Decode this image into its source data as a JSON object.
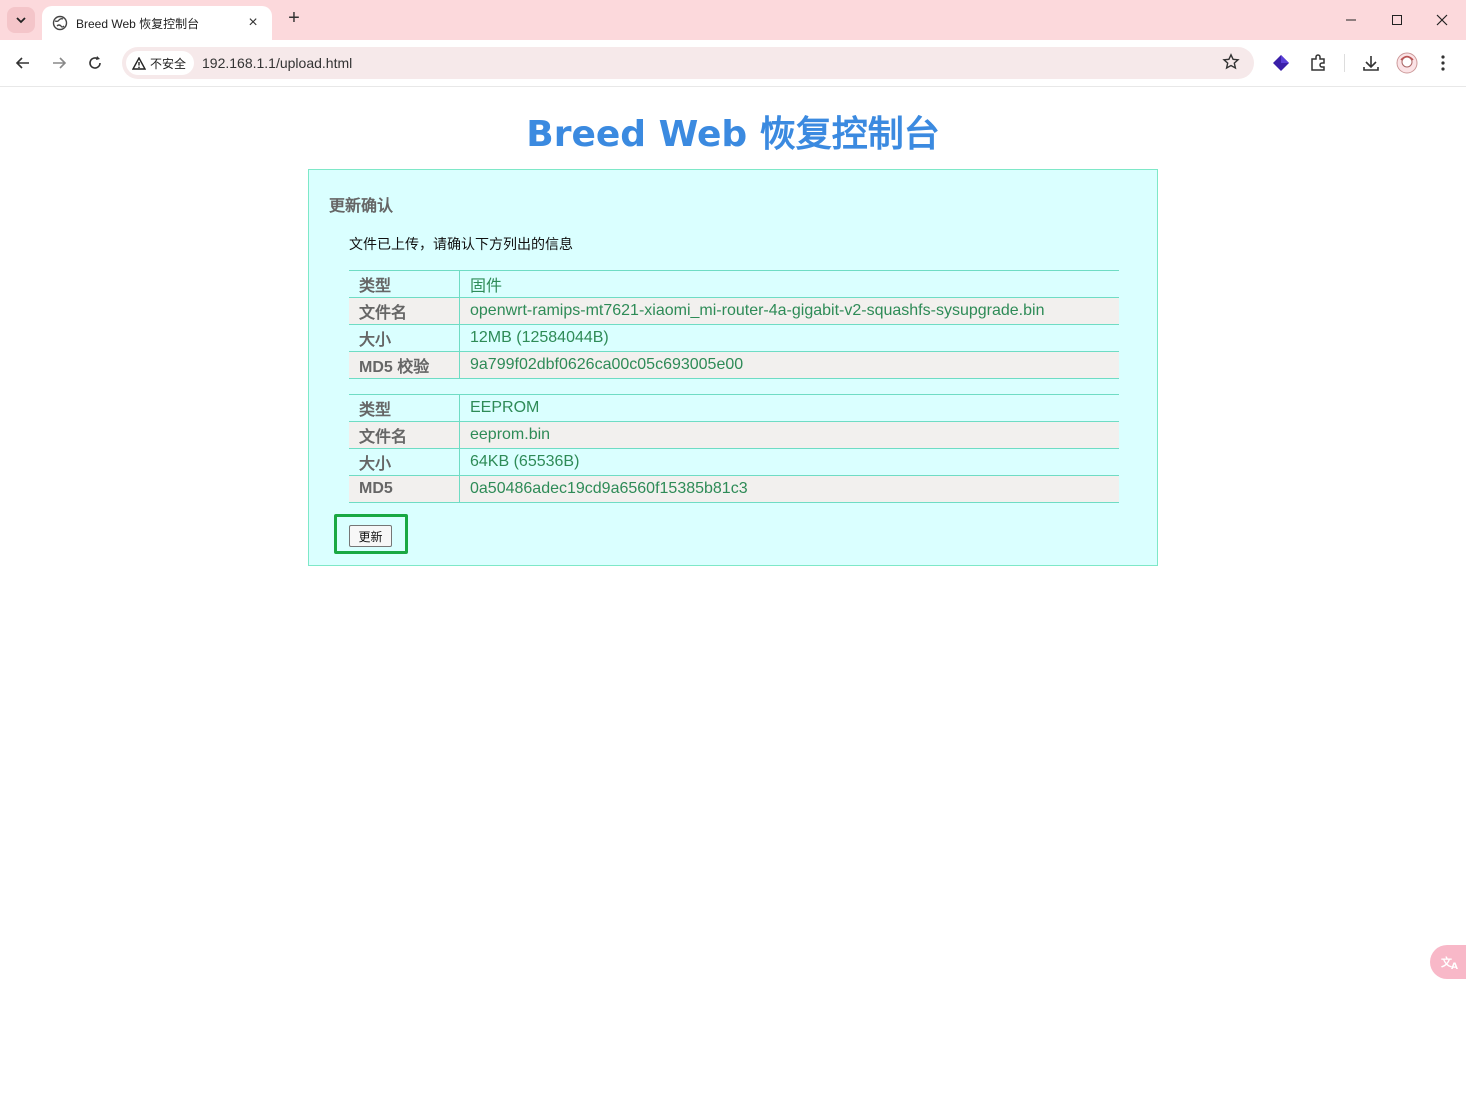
{
  "browser": {
    "tab_title": "Breed Web 恢复控制台",
    "new_tab": "+",
    "tab_close": "×",
    "security_label": "不安全",
    "url": "192.168.1.1/upload.html"
  },
  "page": {
    "heading": "Breed Web 恢复控制台",
    "panel_title": "更新确认",
    "intro": "文件已上传，请确认下方列出的信息",
    "firmware": [
      {
        "key": "类型",
        "value": "固件"
      },
      {
        "key": "文件名",
        "value": "openwrt-ramips-mt7621-xiaomi_mi-router-4a-gigabit-v2-squashfs-sysupgrade.bin"
      },
      {
        "key": "大小",
        "value": "12MB (12584044B)"
      },
      {
        "key": "MD5 校验",
        "value": "9a799f02dbf0626ca00c05c693005e00"
      }
    ],
    "eeprom": [
      {
        "key": "类型",
        "value": "EEPROM"
      },
      {
        "key": "文件名",
        "value": "eeprom.bin"
      },
      {
        "key": "大小",
        "value": "64KB (65536B)"
      },
      {
        "key": "MD5",
        "value": "0a50486adec19cd9a6560f15385b81c3"
      }
    ],
    "update_button": "更新"
  },
  "colors": {
    "heading": "#3b8ae0",
    "panel_bg": "#daffff",
    "value_text": "#2e8b57",
    "highlight": "#1aa843",
    "titlebar": "#fcd9dc"
  },
  "icons": [
    "tab-search-icon",
    "globe-icon",
    "back-icon",
    "forward-icon",
    "reload-icon",
    "warning-icon",
    "star-icon",
    "extension-diamond-icon",
    "extensions-puzzle-icon",
    "download-icon",
    "profile-avatar-icon",
    "more-menu-icon",
    "translate-icon"
  ]
}
